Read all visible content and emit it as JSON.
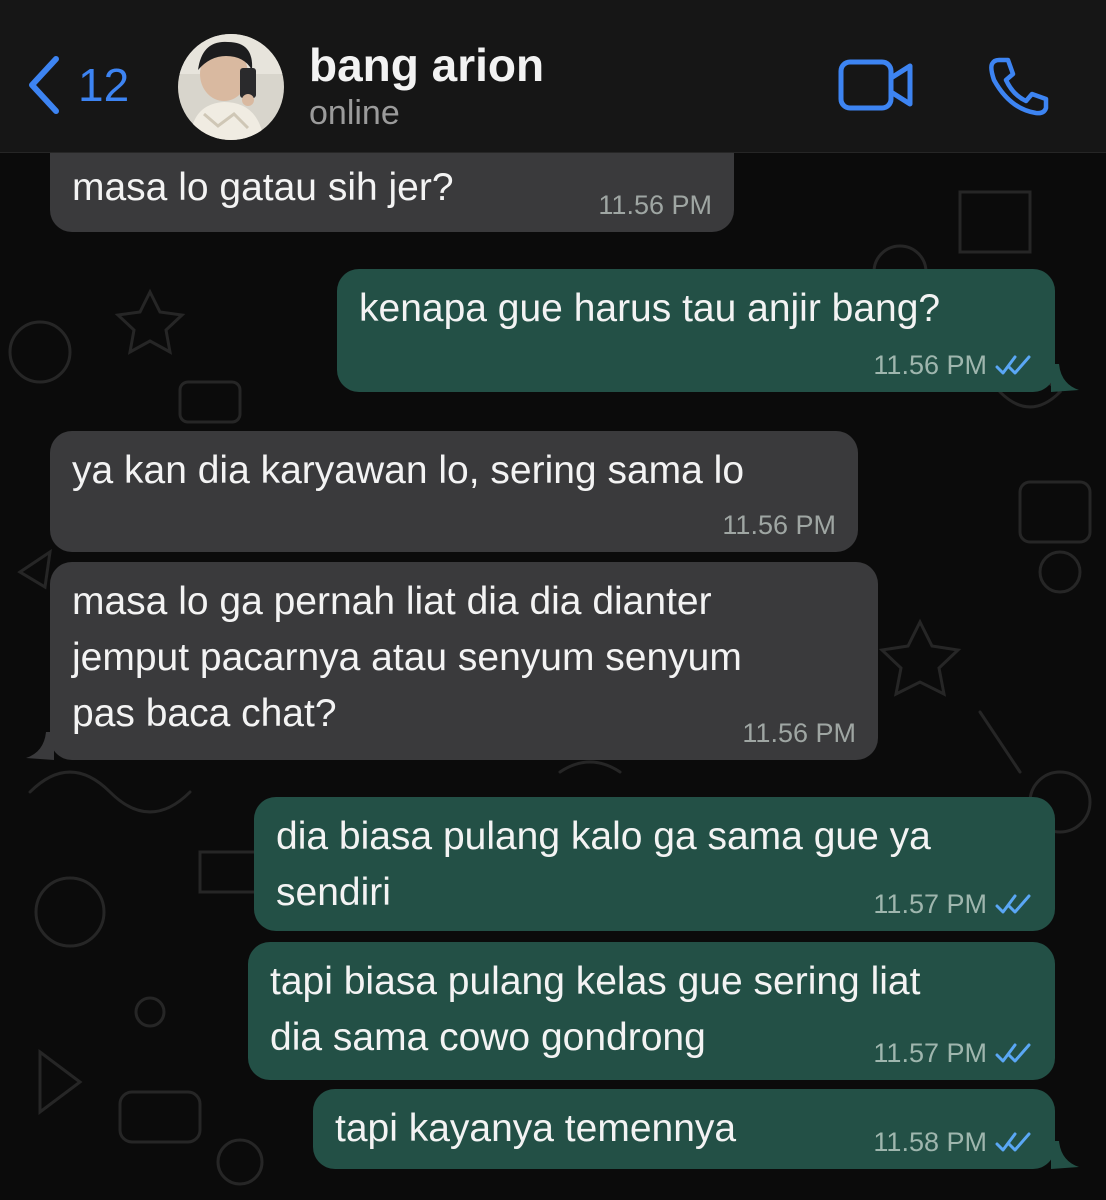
{
  "header": {
    "back_count": "12",
    "contact_name": "bang arion",
    "contact_status": "online",
    "accent_color": "#3d84f2",
    "icons": [
      "chevron-left-icon",
      "video-camera-icon",
      "phone-icon"
    ]
  },
  "colors": {
    "incoming_bubble": "#3a3a3c",
    "outgoing_bubble": "#235046",
    "read_ticks": "#5aa7f5"
  },
  "messages": [
    {
      "direction": "incoming",
      "text": "masa lo gatau sih jer?",
      "time": "11.56 PM"
    },
    {
      "direction": "outgoing",
      "text": "kenapa gue harus tau anjir bang?",
      "time": "11.56 PM",
      "status": "read"
    },
    {
      "direction": "incoming",
      "text": "ya kan dia karyawan lo, sering sama lo",
      "time": "11.56 PM"
    },
    {
      "direction": "incoming",
      "text": "masa lo ga pernah liat dia dia dianter\njemput pacarnya atau senyum senyum\npas baca chat?",
      "time": "11.56 PM"
    },
    {
      "direction": "outgoing",
      "text": "dia biasa pulang kalo ga sama gue ya\nsendiri",
      "time": "11.57 PM",
      "status": "read"
    },
    {
      "direction": "outgoing",
      "text": "tapi biasa pulang kelas gue sering liat\ndia sama cowo gondrong",
      "time": "11.57 PM",
      "status": "read"
    },
    {
      "direction": "outgoing",
      "text": "tapi kayanya temennya",
      "time": "11.58 PM",
      "status": "read"
    }
  ]
}
